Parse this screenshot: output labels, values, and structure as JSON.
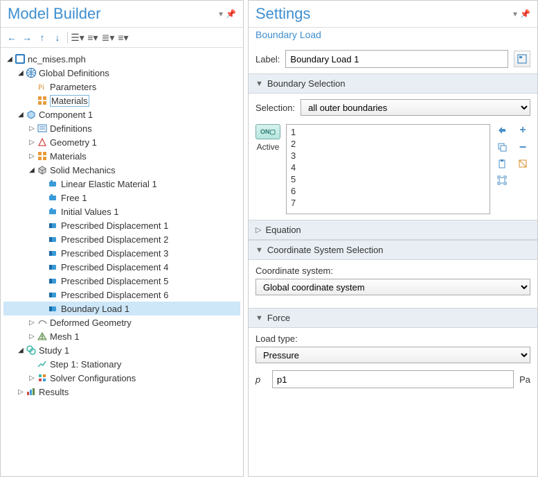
{
  "left": {
    "title": "Model Builder",
    "tree": [
      {
        "d": 0,
        "exp": "▢",
        "icon": "mph",
        "label": "nc_mises.mph"
      },
      {
        "d": 1,
        "exp": "▢",
        "icon": "globe",
        "label": "Global Definitions"
      },
      {
        "d": 2,
        "exp": "",
        "icon": "pi",
        "label": "Parameters"
      },
      {
        "d": 2,
        "exp": "",
        "icon": "mat",
        "label": "Materials",
        "boxed": true
      },
      {
        "d": 1,
        "exp": "▢",
        "icon": "comp",
        "label": "Component 1"
      },
      {
        "d": 2,
        "exp": "▷",
        "icon": "def",
        "label": "Definitions"
      },
      {
        "d": 2,
        "exp": "▷",
        "icon": "geom",
        "label": "Geometry 1"
      },
      {
        "d": 2,
        "exp": "▷",
        "icon": "mat",
        "label": "Materials"
      },
      {
        "d": 2,
        "exp": "▢",
        "icon": "solid",
        "label": "Solid Mechanics"
      },
      {
        "d": 3,
        "exp": "",
        "icon": "fnode",
        "label": "Linear Elastic Material 1"
      },
      {
        "d": 3,
        "exp": "",
        "icon": "fnode",
        "label": "Free 1"
      },
      {
        "d": 3,
        "exp": "",
        "icon": "fnode",
        "label": "Initial Values 1"
      },
      {
        "d": 3,
        "exp": "",
        "icon": "bnode",
        "label": "Prescribed Displacement 1"
      },
      {
        "d": 3,
        "exp": "",
        "icon": "bnode",
        "label": "Prescribed Displacement 2"
      },
      {
        "d": 3,
        "exp": "",
        "icon": "bnode",
        "label": "Prescribed Displacement 3"
      },
      {
        "d": 3,
        "exp": "",
        "icon": "bnode",
        "label": "Prescribed Displacement 4"
      },
      {
        "d": 3,
        "exp": "",
        "icon": "bnode",
        "label": "Prescribed Displacement 5"
      },
      {
        "d": 3,
        "exp": "",
        "icon": "bnode",
        "label": "Prescribed Displacement 6"
      },
      {
        "d": 3,
        "exp": "",
        "icon": "bnode",
        "label": "Boundary Load 1",
        "selected": true
      },
      {
        "d": 2,
        "exp": "▷",
        "icon": "defgeom",
        "label": "Deformed Geometry"
      },
      {
        "d": 2,
        "exp": "▷",
        "icon": "mesh",
        "label": "Mesh 1"
      },
      {
        "d": 1,
        "exp": "▢",
        "icon": "study",
        "label": "Study 1"
      },
      {
        "d": 2,
        "exp": "",
        "icon": "step",
        "label": "Step 1: Stationary"
      },
      {
        "d": 2,
        "exp": "▷",
        "icon": "solver",
        "label": "Solver Configurations"
      },
      {
        "d": 1,
        "exp": "▷",
        "icon": "results",
        "label": "Results"
      }
    ]
  },
  "right": {
    "title": "Settings",
    "subtitle": "Boundary Load",
    "label_field": "Label:",
    "label_value": "Boundary Load 1",
    "sections": {
      "boundary_selection": "Boundary Selection",
      "selection_label": "Selection:",
      "selection_value": "all outer boundaries",
      "active": "Active",
      "toggle": "ON",
      "list": [
        "1",
        "2",
        "3",
        "4",
        "5",
        "6",
        "7"
      ],
      "equation": "Equation",
      "coord_sys": "Coordinate System Selection",
      "coord_label": "Coordinate system:",
      "coord_value": "Global coordinate system",
      "force": "Force",
      "load_type_label": "Load type:",
      "load_type_value": "Pressure",
      "p_symbol": "p",
      "p_value": "p1",
      "p_unit": "Pa"
    }
  }
}
